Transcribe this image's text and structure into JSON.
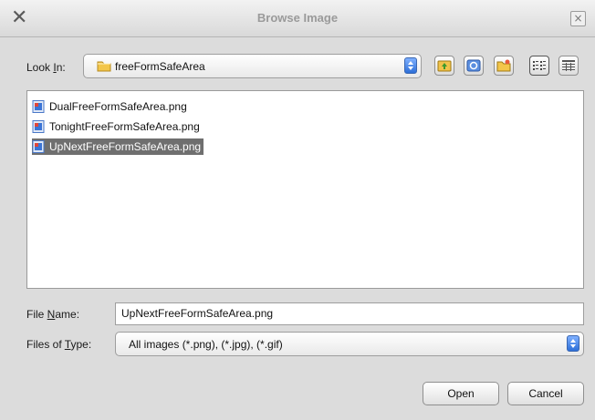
{
  "window": {
    "title": "Browse Image",
    "close_glyph": "×"
  },
  "look_in": {
    "label_pre": "Look ",
    "label_ul": "I",
    "label_post": "n:",
    "value": "freeFormSafeArea"
  },
  "toolbar": {
    "icons": [
      "up-folder-icon",
      "home-icon",
      "new-folder-icon",
      "list-view-icon",
      "details-view-icon"
    ]
  },
  "files": [
    {
      "name": "DualFreeFormSafeArea.png",
      "selected": false
    },
    {
      "name": "TonightFreeFormSafeArea.png",
      "selected": false
    },
    {
      "name": "UpNextFreeFormSafeArea.png",
      "selected": true
    }
  ],
  "file_name": {
    "label_pre": "File ",
    "label_ul": "N",
    "label_post": "ame:",
    "value": "UpNextFreeFormSafeArea.png"
  },
  "file_type": {
    "label_pre": "Files of ",
    "label_ul": "T",
    "label_post": "ype:",
    "value": "All images (*.png), (*.jpg), (*.gif)"
  },
  "buttons": {
    "open": "Open",
    "cancel": "Cancel"
  },
  "colors": {
    "selection": "#6f6f6f",
    "spinner": "#2d6fd8"
  }
}
